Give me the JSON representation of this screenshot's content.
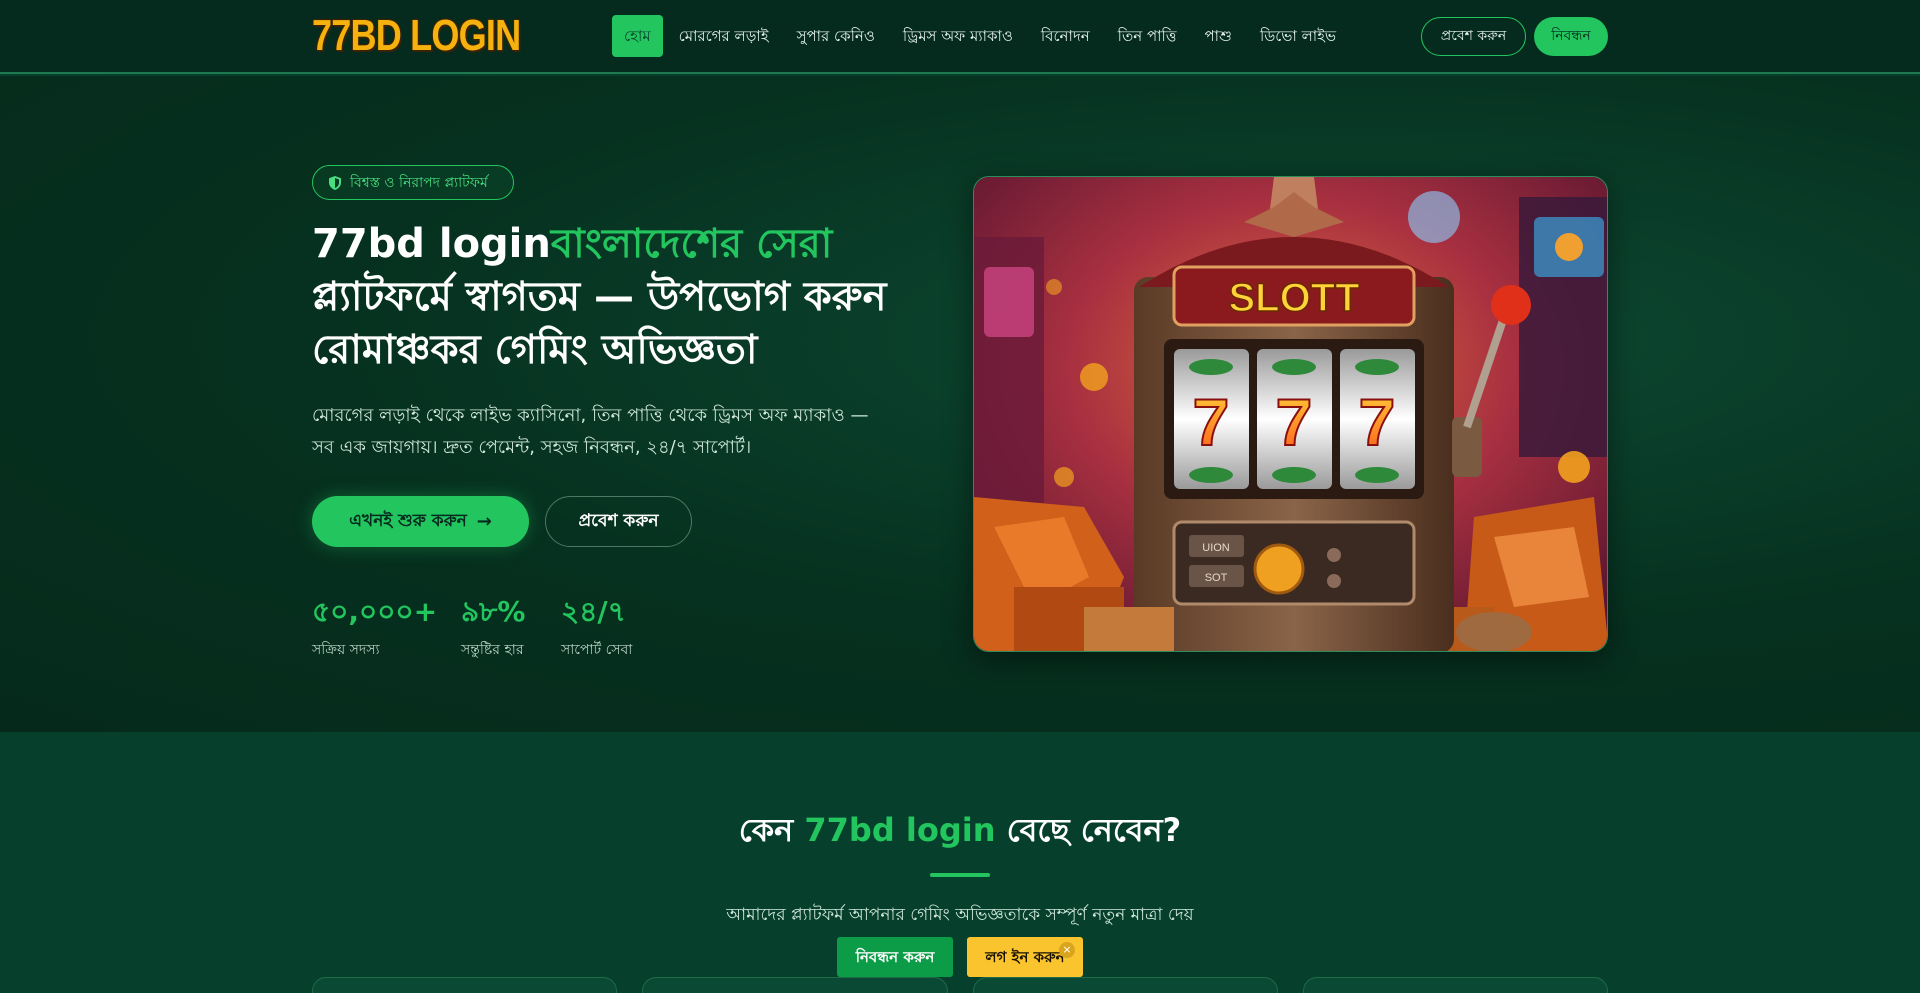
{
  "header": {
    "logo_text": "77BD LOGIN",
    "nav": [
      {
        "label": "হোম",
        "active": true
      },
      {
        "label": "মোরগের লড়াই"
      },
      {
        "label": "সুপার কেনিও"
      },
      {
        "label": "ড্রিমস অফ ম্যাকাও"
      },
      {
        "label": "বিনোদন"
      },
      {
        "label": "তিন পাত্তি"
      },
      {
        "label": "পাশু"
      },
      {
        "label": "ডিভো লাইভ"
      }
    ],
    "login_label": "প্রবেশ করুন",
    "register_label": "নিবন্ধন"
  },
  "hero": {
    "badge": "বিশ্বস্ত ও নিরাপদ প্ল্যাটফর্ম",
    "title_part1": "77bd login",
    "title_accent": "বাংলাদেশের সেরা",
    "title_part2": "প্ল্যাটফর্মে স্বাগতম — উপভোগ করুন রোমাঞ্চকর গেমিং অভিজ্ঞতা",
    "description": "মোরগের লড়াই থেকে লাইভ ক্যাসিনো, তিন পাত্তি থেকে ড্রিমস অফ ম্যাকাও — সব এক জায়গায়। দ্রুত পেমেন্ট, সহজ নিবন্ধন, ২৪/৭ সাপোর্ট।",
    "start_label": "এখনই শুরু করুন",
    "login_label": "প্রবেশ করুন",
    "stats": [
      {
        "value": "৫০,০০০+",
        "label": "সক্রিয় সদস্য"
      },
      {
        "value": "৯৮%",
        "label": "সন্তুষ্টির হার"
      },
      {
        "value": "২৪/৭",
        "label": "সাপোর্ট সেবা"
      }
    ],
    "image": {
      "slot_sign": "SLOTT",
      "button_1": "UION",
      "button_2": "SOT",
      "reel_symbol": "7"
    }
  },
  "why": {
    "title_part1": "কেন ",
    "title_accent": "77bd login",
    "title_part2": " বেছে নেবেন?",
    "subtitle": "আমাদের প্ল্যাটফর্ম আপনার গেমিং অভিজ্ঞতাকে সম্পূর্ণ নতুন মাত্রা দেয়"
  },
  "floating_bar": {
    "register_label": "নিবন্ধন করুন",
    "login_label": "লগ ইন করুন",
    "close_label": "×"
  },
  "colors": {
    "accent": "#22c55e",
    "header_bg": "#052b1f",
    "section_bg": "#063f2c",
    "cta_green": "#0c9c47",
    "cta_yellow": "#fac42e"
  }
}
